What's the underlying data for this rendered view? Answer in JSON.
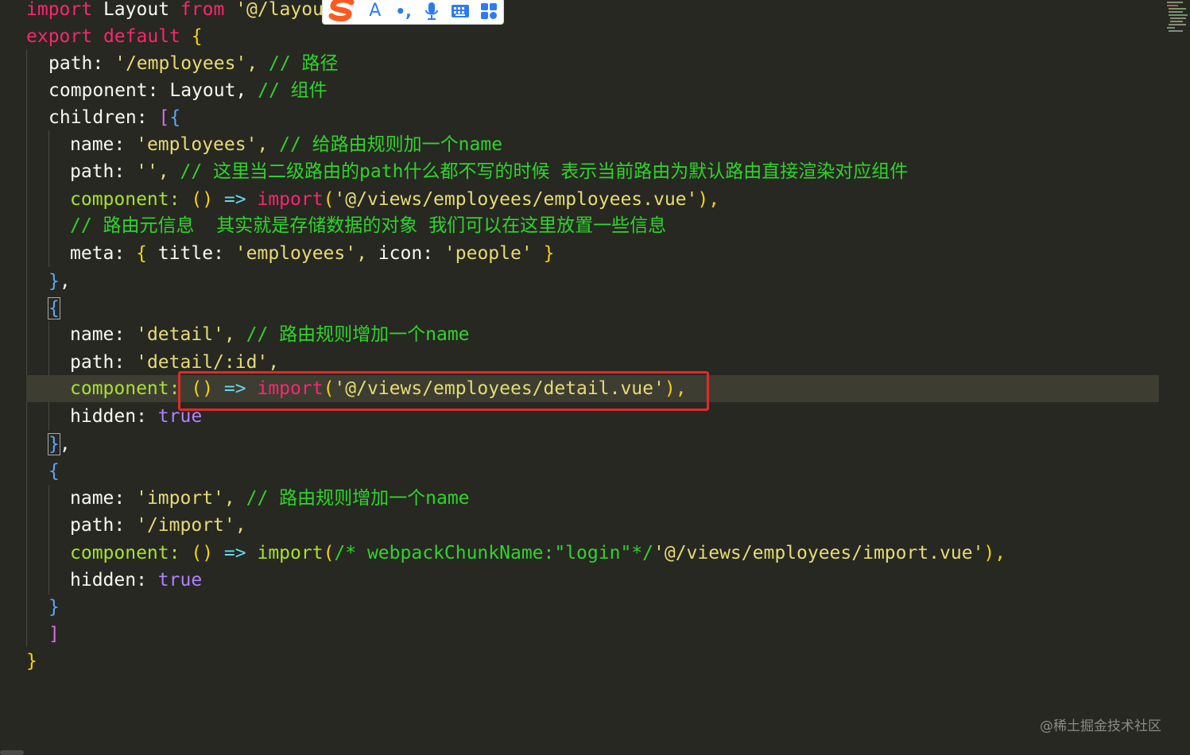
{
  "code": {
    "l1": {
      "kw": "import",
      "ident": "Layout",
      "from": "from",
      "path": "'@/layou"
    },
    "l2": {
      "kw1": "export",
      "kw2": "default",
      "brace": "{"
    },
    "l3": {
      "key": "path:",
      "val": "'/employees',",
      "comment": "// 路径"
    },
    "l4": {
      "key": "component:",
      "val": "Layout,",
      "comment": "// 组件"
    },
    "l5": {
      "key": "children:",
      "bracket": "[",
      "brace": "{"
    },
    "l6": {
      "key": "name:",
      "val": "'employees',",
      "comment": "// 给路由规则加一个name"
    },
    "l7": {
      "key": "path:",
      "val": "'',",
      "comment": "// 这里当二级路由的path什么都不写的时候 表示当前路由为默认路由直接渲染对应组件"
    },
    "l8": {
      "key": "component:",
      "parens": "()",
      "arrow": "=>",
      "fn": "import",
      "open": "(",
      "str": "'@/views/employees/employees.vue'",
      "close": "),"
    },
    "l9": {
      "comment": "// 路由元信息  其实就是存储数据的对象 我们可以在这里放置一些信息"
    },
    "l10": {
      "key": "meta:",
      "open": "{",
      "k1": "title:",
      "v1": "'employees',",
      "k2": "icon:",
      "v2": "'people'",
      "close": "}"
    },
    "l11": {
      "text": "},",
      "brace": "}",
      "comma": ","
    },
    "l12": {
      "brace": "{"
    },
    "l13": {
      "key": "name:",
      "val": "'detail',",
      "comment": "// 路由规则增加一个name"
    },
    "l14": {
      "key": "path:",
      "val": "'detail/:id',"
    },
    "l15": {
      "key": "component:",
      "parens": "()",
      "arrow": "=>",
      "fn": "import",
      "open": "(",
      "str": "'@/views/employees/detail.vue'",
      "close": "),"
    },
    "l16": {
      "key": "hidden:",
      "val": "true"
    },
    "l17": {
      "brace": "}",
      "comma": ","
    },
    "l18": {
      "brace": "{"
    },
    "l19": {
      "key": "name:",
      "val": "'import',",
      "comment": "// 路由规则增加一个name"
    },
    "l20": {
      "key": "path:",
      "val": "'/import',"
    },
    "l21": {
      "key": "component:",
      "parens": "()",
      "arrow": "=>",
      "fn": "import",
      "open": "(",
      "comment": "/* webpackChunkName:\"login\"*/",
      "str": "'@/views/employees/import.vue'",
      "close": "),"
    },
    "l22": {
      "key": "hidden:",
      "val": "true"
    },
    "l23": {
      "brace": "}"
    },
    "l24": {
      "bracket": "]"
    },
    "l25": {
      "brace": "}"
    }
  },
  "ime": {
    "font_label": "A",
    "punct_label": "•,",
    "icons": [
      "sogou-logo-icon",
      "font-icon",
      "punctuation-icon",
      "microphone-icon",
      "keyboard-icon",
      "toolbox-icon"
    ]
  },
  "watermark": "@稀土掘金技术社区",
  "colors": {
    "background": "#272822",
    "keyword": "#f92672",
    "string": "#e6db74",
    "comment": "#2fd42b",
    "function": "#a6e22e",
    "boolean": "#ae81ff",
    "highlight_box": "#e02a2a"
  }
}
